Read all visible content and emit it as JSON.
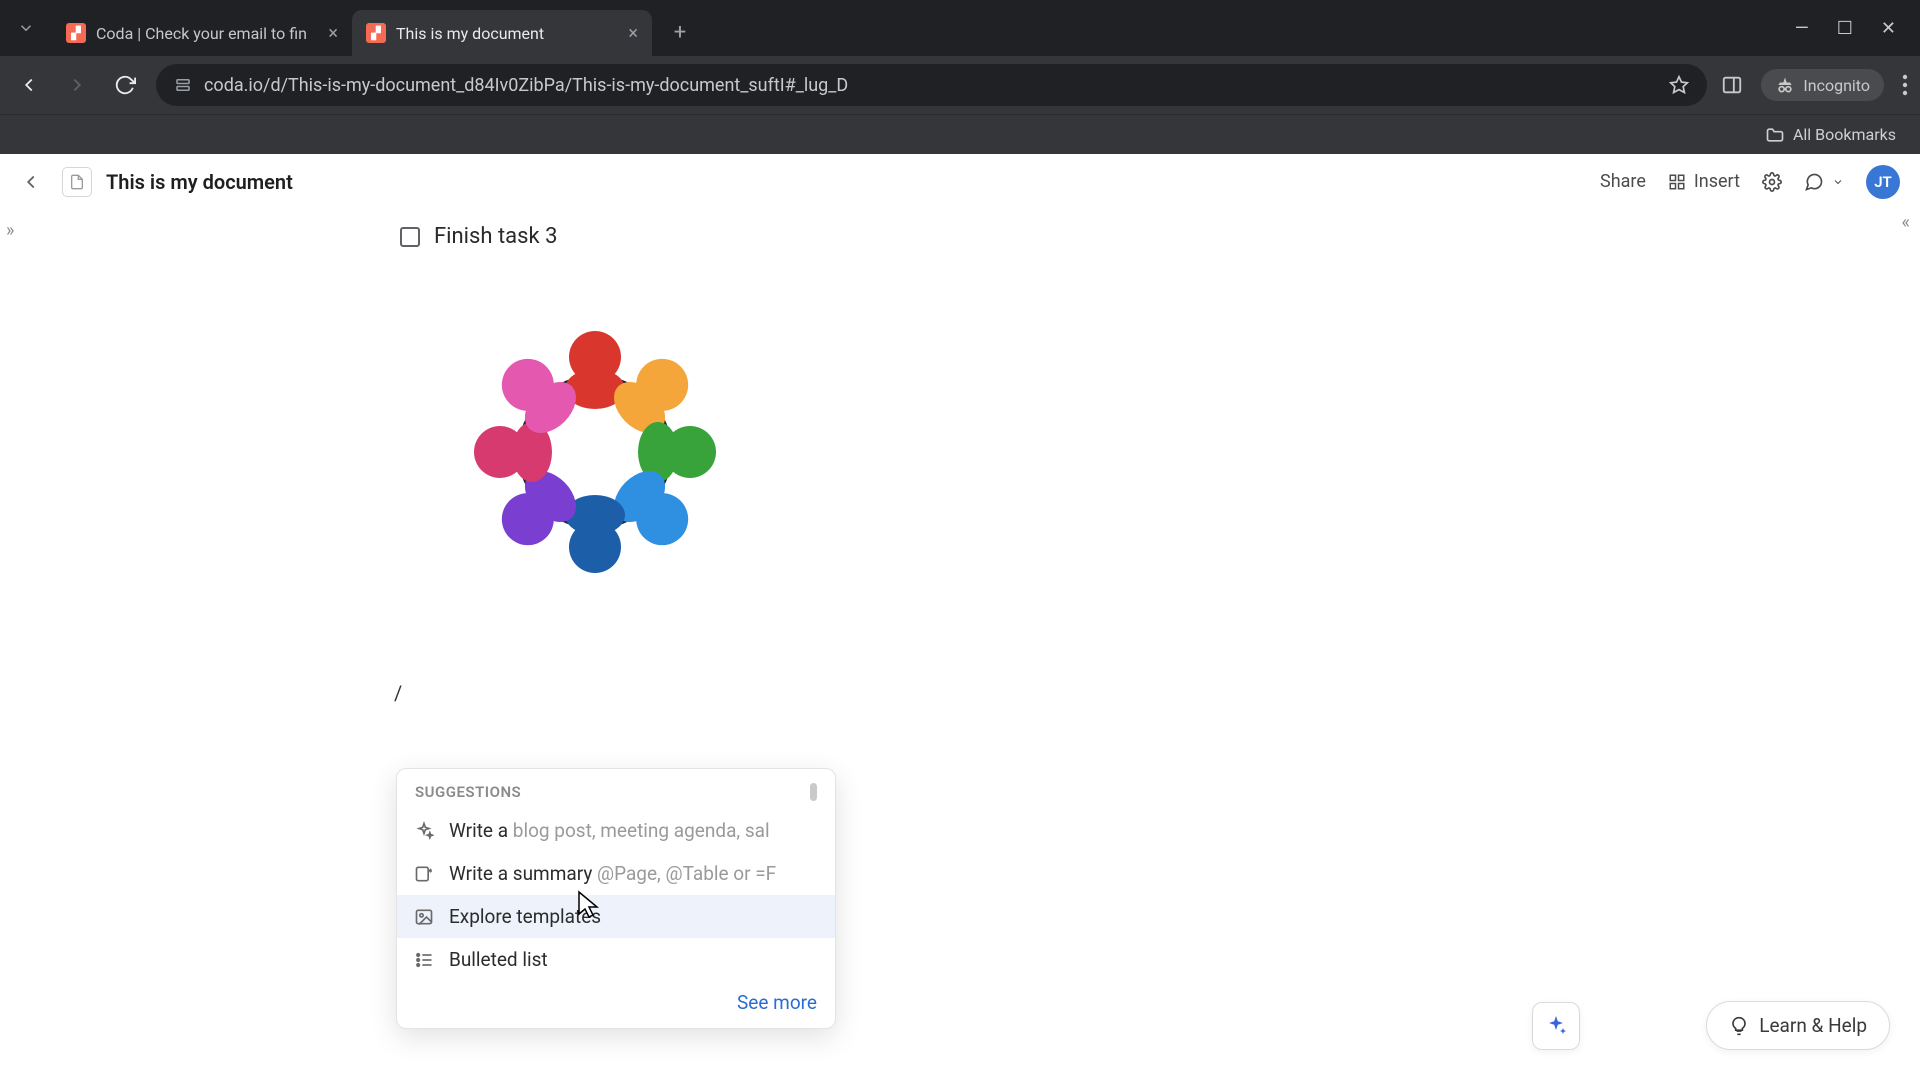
{
  "browser": {
    "tabs": [
      {
        "title": "Coda | Check your email to fin",
        "active": false
      },
      {
        "title": "This is my document",
        "active": true
      }
    ],
    "url_display": "coda.io/d/This-is-my-document_d84Iv0ZibPa/This-is-my-document_suftI#_lug_D",
    "incognito_label": "Incognito",
    "all_bookmarks": "All Bookmarks"
  },
  "header": {
    "doc_title": "This is my document",
    "share": "Share",
    "insert": "Insert",
    "avatar_initials": "JT"
  },
  "content": {
    "task_label": "Finish task 3",
    "slash": "/"
  },
  "suggestions": {
    "heading": "SUGGESTIONS",
    "items": [
      {
        "icon": "sparkle",
        "label": "Write a ",
        "hint": "blog post, meeting agenda, sal"
      },
      {
        "icon": "summary",
        "label": "Write a summary ",
        "hint": "@Page, @Table or =F"
      },
      {
        "icon": "image",
        "label": "Explore templates",
        "hint": ""
      },
      {
        "icon": "list",
        "label": "Bulleted list",
        "hint": ""
      }
    ],
    "see_more": "See more"
  },
  "footer": {
    "learn_help": "Learn & Help"
  }
}
